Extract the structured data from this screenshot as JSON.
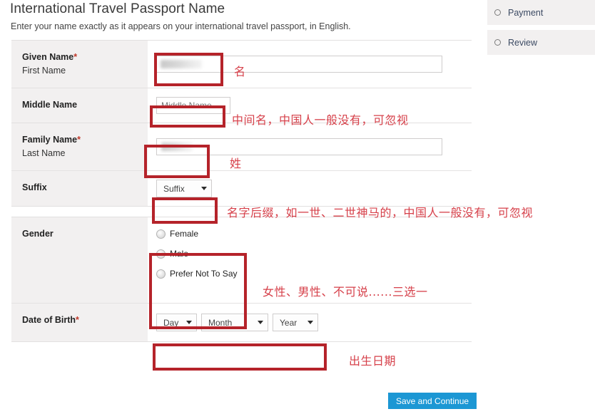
{
  "page": {
    "title": "International Travel Passport Name",
    "subtitle": "Enter your name exactly as it appears on your international travel passport, in English."
  },
  "form": {
    "rows": {
      "given_name": {
        "label": "Given Name",
        "required_mark": "*",
        "sublabel": "First Name",
        "value": "",
        "annotation": "名"
      },
      "middle_name": {
        "label": "Middle Name",
        "placeholder": "Middle Name",
        "value": "",
        "annotation": "中间名，中国人一般没有，可忽视"
      },
      "family_name": {
        "label": "Family Name",
        "required_mark": "*",
        "sublabel": "Last Name",
        "value": "",
        "annotation": "姓"
      },
      "suffix": {
        "label": "Suffix",
        "selected": "Suffix",
        "annotation": "名字后缀，如一世、二世神马的，中国人一般没有，可忽视"
      },
      "gender": {
        "label": "Gender",
        "options": [
          "Female",
          "Male",
          "Prefer Not To Say"
        ],
        "selected": "",
        "annotation": "女性、男性、不可说......三选一"
      },
      "date_of_birth": {
        "label": "Date of Birth",
        "required_mark": "*",
        "day": "Day",
        "month": "Month",
        "year": "Year",
        "annotation": "出生日期"
      }
    }
  },
  "sidebar": {
    "steps": [
      {
        "label": "Payment",
        "bullet": "circle-outline-icon"
      },
      {
        "label": "Review",
        "bullet": "circle-outline-icon"
      }
    ]
  },
  "actions": {
    "save_label": "Save and Continue"
  },
  "colors": {
    "annotation_red": "#d6404a",
    "redbox_border": "#b5232a",
    "primary_button": "#1c97d4",
    "label_bg": "#f2f0f0",
    "required_star": "#c0392b"
  }
}
